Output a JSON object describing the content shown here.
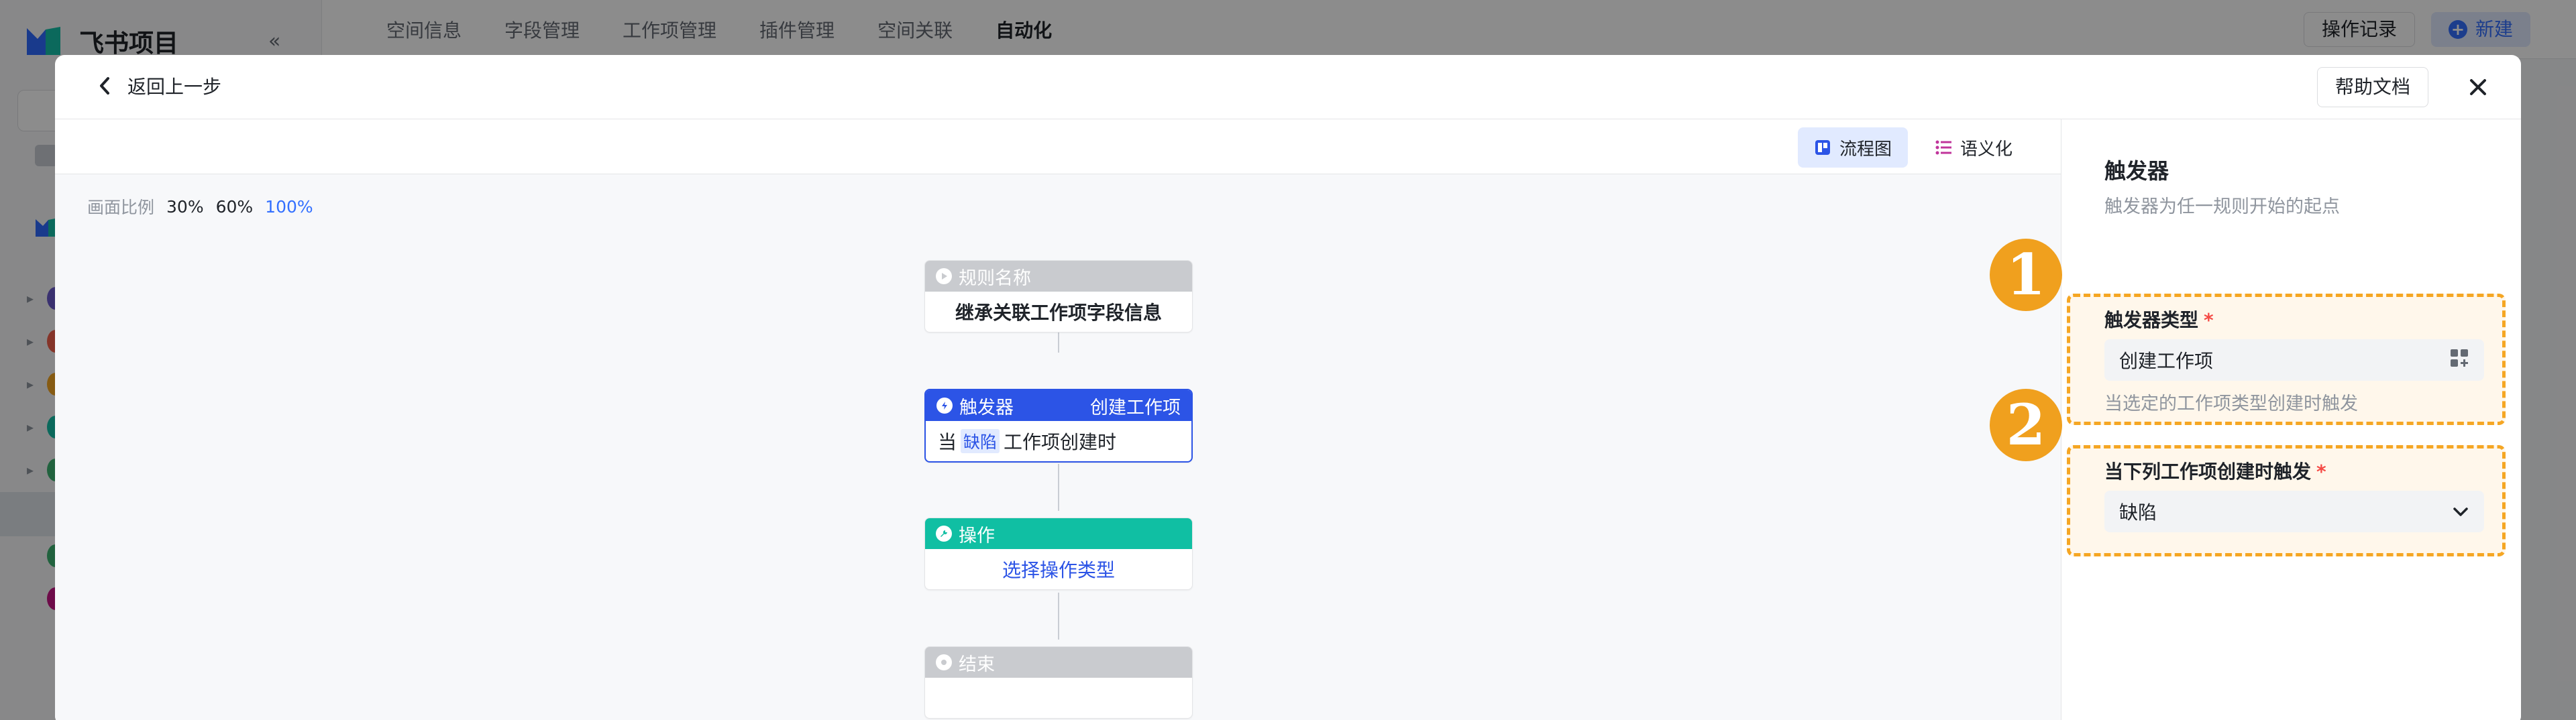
{
  "app": {
    "name": "飞书项目",
    "collapse_icon": "«",
    "nav_tabs": [
      "空间信息",
      "字段管理",
      "工作项管理",
      "插件管理",
      "空间关联",
      "自动化"
    ],
    "active_tab": "自动化",
    "ops_record": "操作记录",
    "new_button": "新建"
  },
  "modal": {
    "back_label": "返回上一步",
    "help_label": "帮助文档"
  },
  "toolbar": {
    "flow_view": "流程图",
    "semantic_view": "语义化"
  },
  "zoom": {
    "label": "画面比例",
    "options": [
      "30%",
      "60%",
      "100%"
    ],
    "active": "100%"
  },
  "flow": {
    "rule": {
      "head": "规则名称",
      "body": "继承关联工作项字段信息"
    },
    "trigger": {
      "head": "触发器",
      "head_right": "创建工作项",
      "body_prefix": "当",
      "tag": "缺陷",
      "body_suffix": "工作项创建时"
    },
    "action": {
      "head": "操作",
      "body": "选择操作类型"
    },
    "end": {
      "head": "结束",
      "body": ""
    },
    "plus": "+"
  },
  "panel": {
    "title": "触发器",
    "desc": "触发器为任一规则开始的起点",
    "trigger_type": {
      "label": "触发器类型",
      "required": "*",
      "value": "创建工作项",
      "hint": "当选定的工作项类型创建时触发"
    },
    "when_created": {
      "label": "当下列工作项创建时触发",
      "required": "*",
      "value": "缺陷"
    }
  },
  "annotations": {
    "one": "1",
    "two": "2"
  },
  "colors": {
    "accent": "#3370ff",
    "trigger_blue": "#2c54e6",
    "action_teal": "#10bfa3",
    "highlight": "#f5a623"
  }
}
